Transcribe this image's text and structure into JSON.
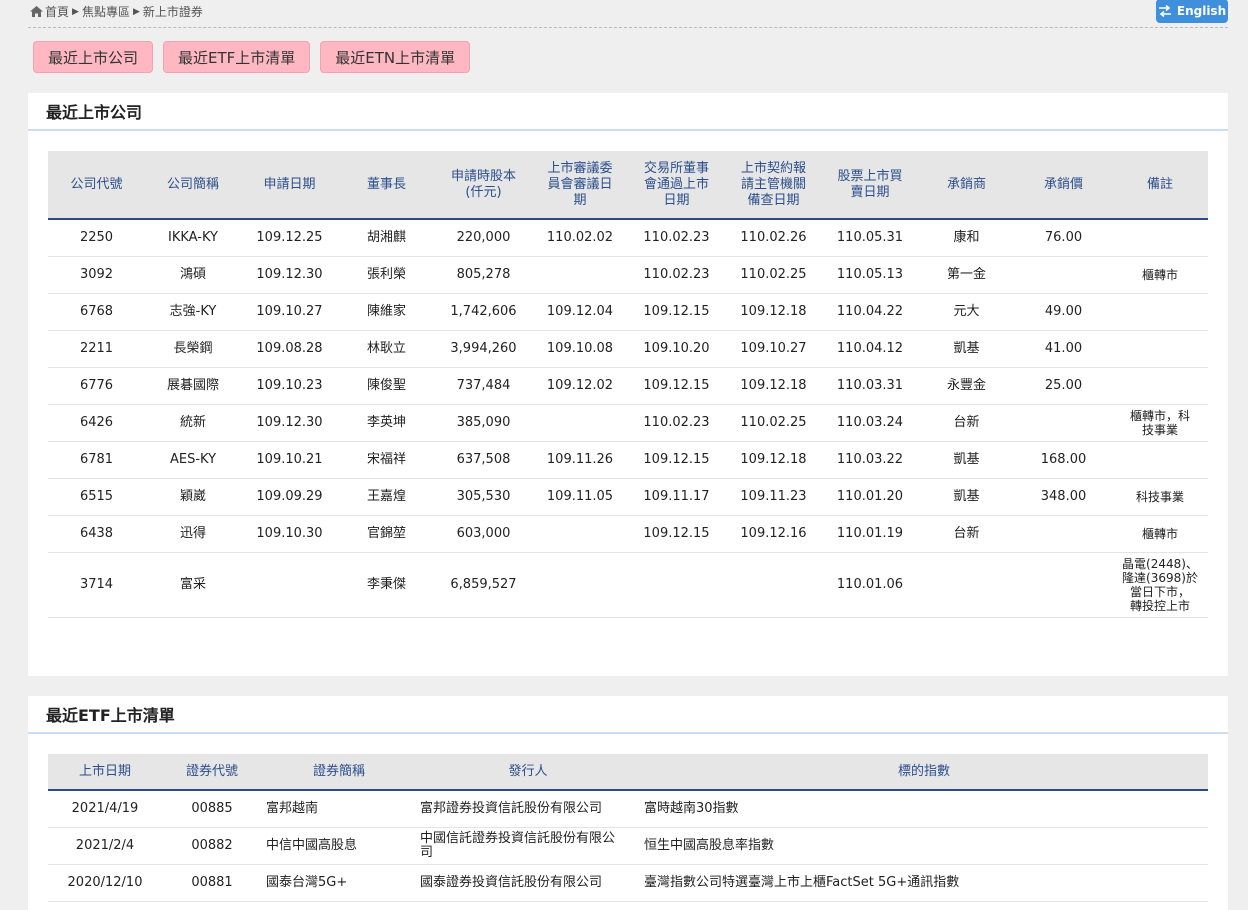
{
  "breadcrumb": [
    "首頁",
    "焦點專區",
    "新上市證券"
  ],
  "lang_button": "English",
  "tabs": [
    "最近上市公司",
    "最近ETF上市清單",
    "最近ETN上市清單"
  ],
  "listed": {
    "title": "最近上市公司",
    "headers": [
      "公司代號",
      "公司簡稱",
      "申請日期",
      "董事長",
      "申請時股本\n(仟元)",
      "上市審議委\n員會審議日\n期",
      "交易所董事\n會通過上市\n日期",
      "上市契約報\n請主管機關\n備查日期",
      "股票上市買\n賣日期",
      "承銷商",
      "承銷價",
      "備註"
    ],
    "rows": [
      [
        "2250",
        "IKKA-KY",
        "109.12.25",
        "胡湘麒",
        "220,000",
        "110.02.02",
        "110.02.23",
        "110.02.26",
        "110.05.31",
        "康和",
        "76.00",
        ""
      ],
      [
        "3092",
        "鴻碩",
        "109.12.30",
        "張利榮",
        "805,278",
        "",
        "110.02.23",
        "110.02.25",
        "110.05.13",
        "第一金",
        "",
        "櫃轉市"
      ],
      [
        "6768",
        "志強-KY",
        "109.10.27",
        "陳維家",
        "1,742,606",
        "109.12.04",
        "109.12.15",
        "109.12.18",
        "110.04.22",
        "元大",
        "49.00",
        ""
      ],
      [
        "2211",
        "長榮鋼",
        "109.08.28",
        "林耿立",
        "3,994,260",
        "109.10.08",
        "109.10.20",
        "109.10.27",
        "110.04.12",
        "凱基",
        "41.00",
        ""
      ],
      [
        "6776",
        "展碁國際",
        "109.10.23",
        "陳俊聖",
        "737,484",
        "109.12.02",
        "109.12.15",
        "109.12.18",
        "110.03.31",
        "永豐金",
        "25.00",
        ""
      ],
      [
        "6426",
        "統新",
        "109.12.30",
        "李英坤",
        "385,090",
        "",
        "110.02.23",
        "110.02.25",
        "110.03.24",
        "台新",
        "",
        "櫃轉市，科\n技事業"
      ],
      [
        "6781",
        "AES-KY",
        "109.10.21",
        "宋福祥",
        "637,508",
        "109.11.26",
        "109.12.15",
        "109.12.18",
        "110.03.22",
        "凱基",
        "168.00",
        ""
      ],
      [
        "6515",
        "穎崴",
        "109.09.29",
        "王嘉煌",
        "305,530",
        "109.11.05",
        "109.11.17",
        "109.11.23",
        "110.01.20",
        "凱基",
        "348.00",
        "科技事業"
      ],
      [
        "6438",
        "迅得",
        "109.10.30",
        "官錦堃",
        "603,000",
        "",
        "109.12.15",
        "109.12.16",
        "110.01.19",
        "台新",
        "",
        "櫃轉市"
      ],
      [
        "3714",
        "富采",
        "",
        "李秉傑",
        "6,859,527",
        "",
        "",
        "",
        "110.01.06",
        "",
        "",
        "晶電(2448)、\n隆達(3698)於\n當日下市，\n轉投控上市"
      ]
    ]
  },
  "etf": {
    "title": "最近ETF上市清單",
    "headers": [
      "上市日期",
      "證券代號",
      "證券簡稱",
      "發行人",
      "標的指數"
    ],
    "rows": [
      [
        "2021/4/19",
        "00885",
        "富邦越南",
        "富邦證券投資信託股份有限公司",
        "富時越南30指數"
      ],
      [
        "2021/2/4",
        "00882",
        "中信中國高股息",
        "中國信託證券投資信託股份有限公\n司",
        "恒生中國高股息率指數"
      ],
      [
        "2020/12/10",
        "00881",
        "國泰台灣5G+",
        "國泰證券投資信託股份有限公司",
        "臺灣指數公司特選臺灣上市上櫃FactSet 5G+通訊指數"
      ]
    ]
  }
}
